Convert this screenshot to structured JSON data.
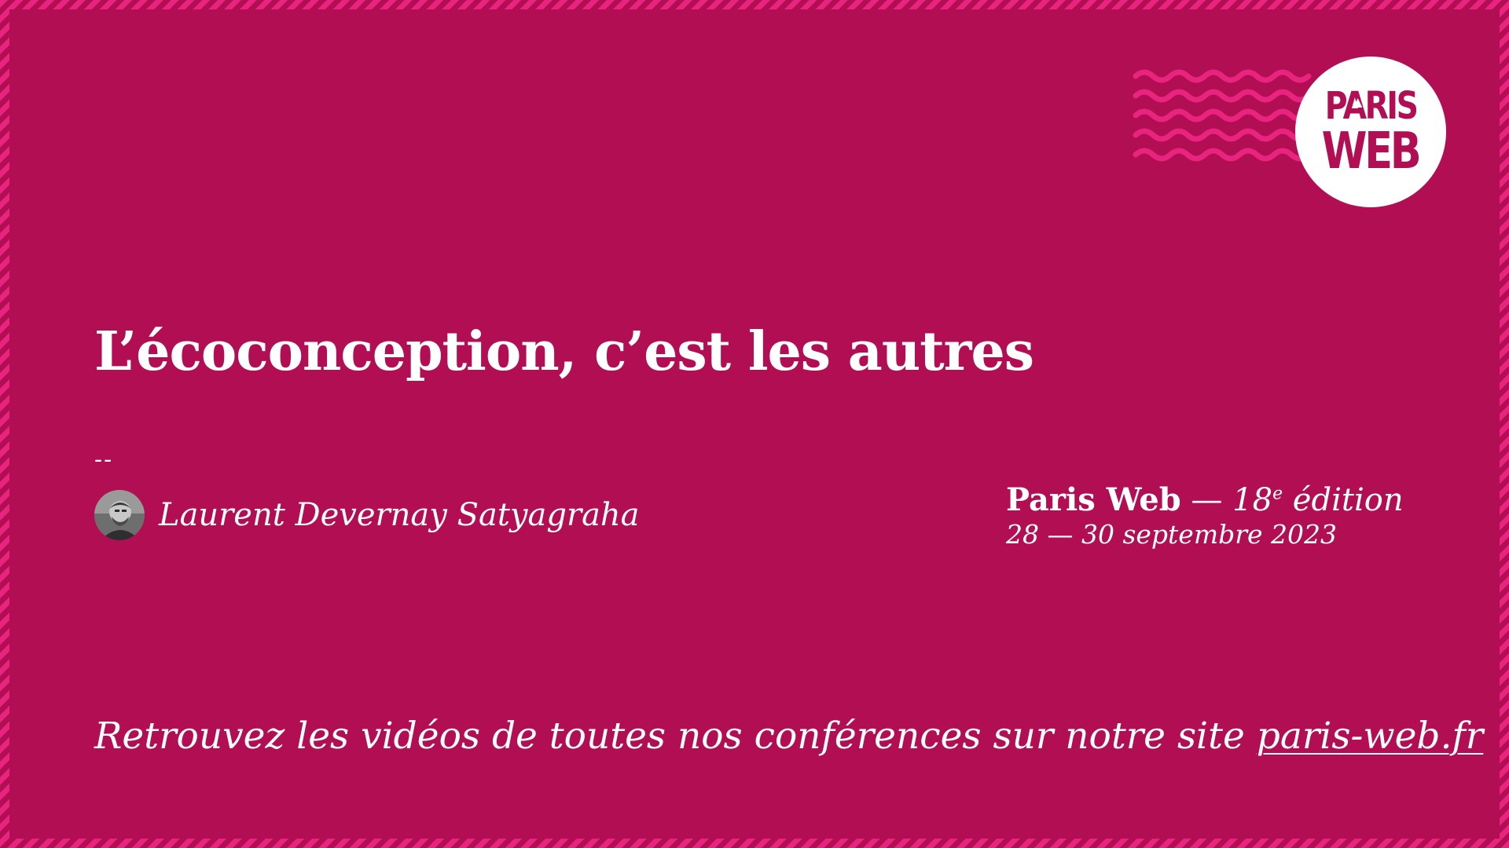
{
  "colors": {
    "background": "#b20e53",
    "accent": "#e8247f",
    "text": "#ffffff"
  },
  "logo": {
    "line1": "PARIS",
    "line2": "WEB"
  },
  "talk": {
    "title": "L’écoconception, c’est les autres",
    "separator": "--",
    "speaker": "Laurent Devernay Satyagraha"
  },
  "event": {
    "name": "Paris Web",
    "dash": " — ",
    "edition_number": "18",
    "edition_suffix": "e",
    "edition_word": " édition",
    "dates": "28 — 30 septembre 2023"
  },
  "footer": {
    "text": "Retrouvez les vidéos de toutes nos conférences sur notre site ",
    "link_label": "paris-web.fr"
  }
}
